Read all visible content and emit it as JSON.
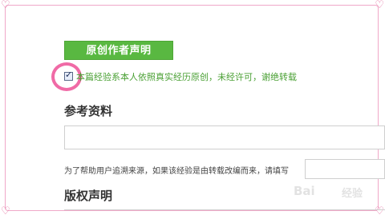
{
  "declaration": {
    "button_label": "原创作者声明",
    "checkbox_checked": true,
    "checkbox_text": "本篇经验系本人依照真实经历原创，未经许可，谢绝转载"
  },
  "references": {
    "title": "参考资料",
    "input_value": "",
    "hint": "为了帮助用户追溯来源，如果该经验是由转载改编而来，请填写",
    "source_value": ""
  },
  "copyright": {
    "title": "版权声明"
  },
  "watermark": {
    "brand": "Bai",
    "sub": "经验"
  },
  "colors": {
    "accent_green": "#59b841",
    "declare_text": "#4aa034",
    "highlight_pink": "#f06aa6",
    "frame_pink": "#f0a8c8"
  },
  "icons": {
    "corner": "heart-icon",
    "checkbox": "checkmark-icon"
  }
}
